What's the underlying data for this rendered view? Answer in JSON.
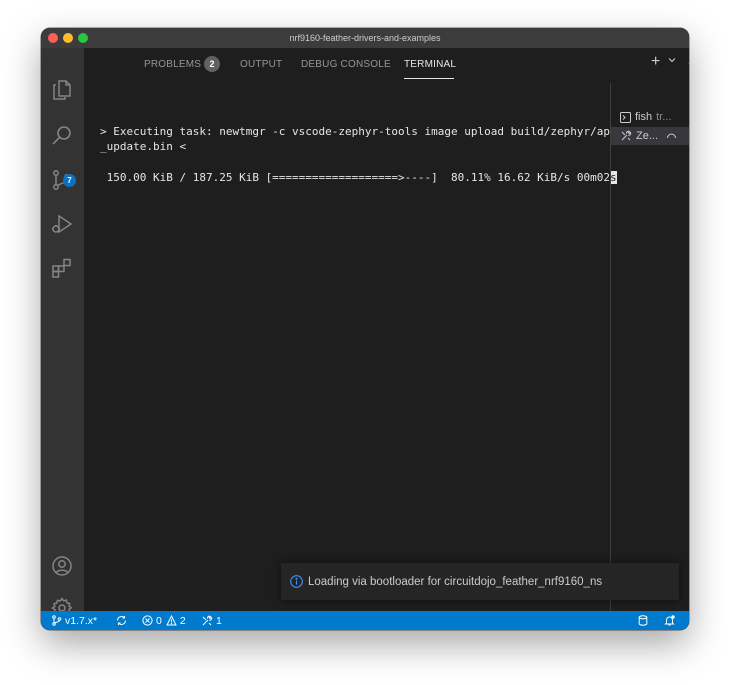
{
  "window": {
    "title": "nrf9160-feather-drivers-and-examples"
  },
  "activity_bar": {
    "source_control_badge": "7"
  },
  "panel": {
    "tabs": [
      {
        "label": "PROBLEMS"
      },
      {
        "label": "OUTPUT"
      },
      {
        "label": "DEBUG CONSOLE"
      },
      {
        "label": "TERMINAL"
      }
    ],
    "active_tab": "TERMINAL",
    "problems_count": "2",
    "actions": {
      "new_terminal": "+",
      "dropdown": "⌄",
      "collapse": "⌄",
      "close": "✕"
    }
  },
  "terminal": {
    "line1": "> Executing task: newtmgr -c vscode-zephyr-tools image upload build/zephyr/app",
    "line2": "_update.bin <",
    "progress_text": " 150.00 KiB / 187.25 KiB [===================>----]  80.11% 16.62 KiB/s 00m02",
    "cursor_char": "s",
    "progress_percent": 80.11
  },
  "terminal_list": [
    {
      "name": "fish",
      "detail": "tr..."
    },
    {
      "name": "Ze...",
      "detail": ""
    }
  ],
  "notification": {
    "text": "Loading via bootloader for circuitdojo_feather_nrf9160_ns"
  },
  "status_bar": {
    "branch": "v1.7.x*",
    "errors": "0",
    "warnings": "2",
    "tasks": "1"
  },
  "colors": {
    "accent": "#007acc",
    "editor_bg": "#1e1e1e",
    "activity_bg": "#333333",
    "badge": "#0e70c0"
  }
}
